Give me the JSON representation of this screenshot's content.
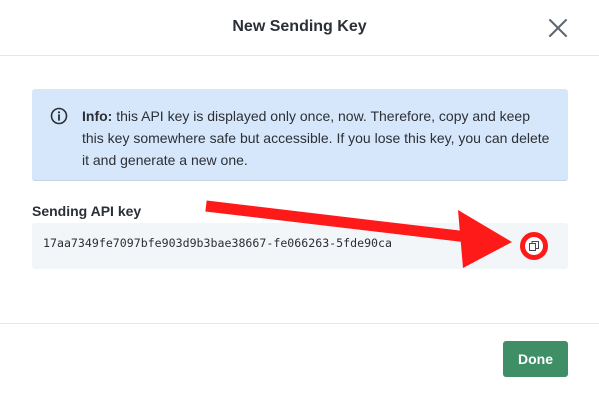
{
  "dialog": {
    "title": "New Sending Key",
    "close_icon": "close-icon"
  },
  "info": {
    "icon": "info-icon",
    "label": "Info:",
    "message": " this API key is displayed only once, now. Therefore, copy and keep this key somewhere safe but accessible. If you lose this key, you can delete it and generate a new one."
  },
  "key": {
    "label": "Sending API key",
    "value": "17aa7349fe7097bfe903d9b3bae38667-fe066263-5fde90ca",
    "copy_icon": "copy-icon"
  },
  "footer": {
    "done_label": "Done"
  },
  "colors": {
    "info_bg": "#d7e7fb",
    "done_button": "#3f8f66",
    "annotation_red": "#ff1a1a"
  }
}
